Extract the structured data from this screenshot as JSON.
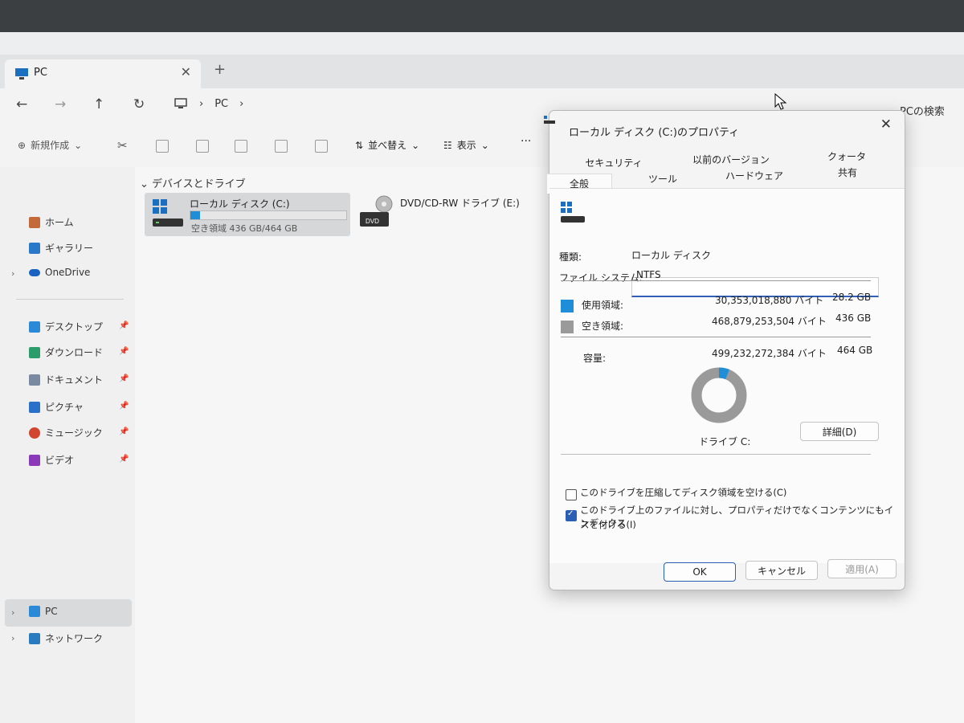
{
  "window": {
    "tab_title": "PC",
    "tab_close": "✕",
    "new_tab": "+",
    "breadcrumb": [
      "PC"
    ],
    "search_label": "PCの検索"
  },
  "toolbar": {
    "new_label": "新規作成",
    "sort_label": "並べ替え",
    "view_label": "表示",
    "more_label": "···"
  },
  "sidebar": {
    "home": "ホーム",
    "gallery": "ギャラリー",
    "onedrive": "OneDrive",
    "desktop": "デスクトップ",
    "downloads": "ダウンロード",
    "documents": "ドキュメント",
    "pictures": "ピクチャ",
    "music": "ミュージック",
    "videos": "ビデオ",
    "pc": "PC",
    "network": "ネットワーク"
  },
  "main": {
    "section_title": "デバイスとドライブ",
    "drive_c": {
      "name": "ローカル ディスク (C:)",
      "space": "空き領域 436 GB/464 GB",
      "used_fraction": 0.06
    },
    "drive_e": {
      "name": "DVD/CD-RW ドライブ (E:)",
      "icon_label": "DVD"
    }
  },
  "dialog": {
    "title": "ローカル ディスク (C:)のプロパティ",
    "tabs_row1": [
      "セキュリティ",
      "以前のバージョン",
      "クォータ"
    ],
    "tabs_row2": [
      "全般",
      "ツール",
      "ハードウェア",
      "共有"
    ],
    "active_tab": "全般",
    "name_value": "",
    "type_label": "種類:",
    "type_value": "ローカル ディスク",
    "fs_label": "ファイル システム:",
    "fs_value": "NTFS",
    "used_label": "使用領域:",
    "used_bytes": "30,353,018,880 バイト",
    "used_gb": "28.2 GB",
    "free_label": "空き領域:",
    "free_bytes": "468,879,253,504 バイト",
    "free_gb": "436 GB",
    "capacity_label": "容量:",
    "capacity_bytes": "499,232,272,384 バイト",
    "capacity_gb": "464 GB",
    "drive_label": "ドライブ C:",
    "details_button": "詳細(D)",
    "compress_label": "このドライブを圧縮してディスク領域を空ける(C)",
    "compress_checked": false,
    "index_label_line1": "このドライブ上のファイルに対し、プロパティだけでなくコンテンツにもインデックス",
    "index_label_line2": "スを付ける(I)",
    "index_checked": true,
    "ok_button": "OK",
    "cancel_button": "キャンセル",
    "apply_button": "適用(A)",
    "used_fraction": 0.061,
    "colors": {
      "used": "#1e8ed8",
      "free": "#9a9a9a"
    }
  }
}
